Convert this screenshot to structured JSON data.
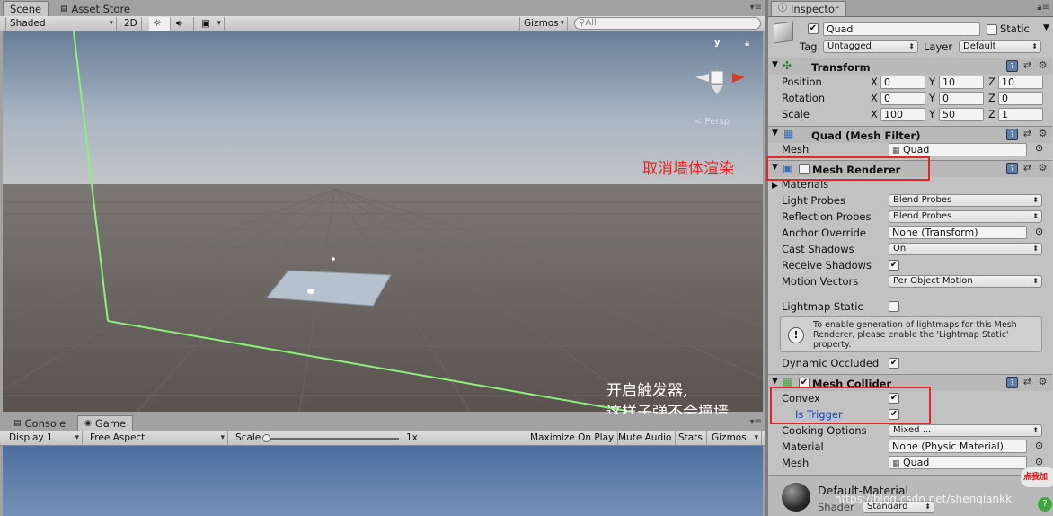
{
  "scene": {
    "tabs": [
      "Scene",
      "Asset Store"
    ],
    "toolbar": {
      "shading": "Shaded",
      "mode_2d": "2D",
      "gizmos": "Gizmos",
      "search_placeholder": "All"
    },
    "gizmo": {
      "y_axis": "y",
      "persp": "< Persp"
    }
  },
  "game": {
    "tabs": [
      "Console",
      "Game"
    ],
    "toolbar": {
      "display": "Display 1",
      "aspect": "Free Aspect",
      "scale_label": "Scale",
      "scale_value": "1x",
      "maximize": "Maximize On Play",
      "mute": "Mute Audio",
      "stats": "Stats",
      "gizmos": "Gizmos"
    }
  },
  "inspector": {
    "tab": "Inspector",
    "object_name": "Quad",
    "static_label": "Static",
    "tag_label": "Tag",
    "tag_value": "Untagged",
    "layer_label": "Layer",
    "layer_value": "Default",
    "transform": {
      "title": "Transform",
      "rows": [
        {
          "label": "Position",
          "x": "0",
          "y": "10",
          "z": "10"
        },
        {
          "label": "Rotation",
          "x": "0",
          "y": "0",
          "z": "0"
        },
        {
          "label": "Scale",
          "x": "100",
          "y": "50",
          "z": "1"
        }
      ],
      "axis": [
        "X",
        "Y",
        "Z"
      ]
    },
    "mesh_filter": {
      "title": "Quad (Mesh Filter)",
      "mesh_label": "Mesh",
      "mesh_value": "Quad"
    },
    "mesh_renderer": {
      "title": "Mesh Renderer",
      "materials": "Materials",
      "light_probes_label": "Light Probes",
      "light_probes_value": "Blend Probes",
      "reflection_probes_label": "Reflection Probes",
      "reflection_probes_value": "Blend Probes",
      "anchor_label": "Anchor Override",
      "anchor_value": "None (Transform)",
      "cast_shadows_label": "Cast Shadows",
      "cast_shadows_value": "On",
      "receive_shadows_label": "Receive Shadows",
      "motion_vectors_label": "Motion Vectors",
      "motion_vectors_value": "Per Object Motion",
      "lightmap_static_label": "Lightmap Static",
      "info_text": "To enable generation of lightmaps for this Mesh Renderer, please enable the 'Lightmap Static' property.",
      "dynamic_occluded_label": "Dynamic Occluded"
    },
    "mesh_collider": {
      "title": "Mesh Collider",
      "convex_label": "Convex",
      "is_trigger_label": "Is Trigger",
      "cooking_label": "Cooking Options",
      "cooking_value": "Mixed ...",
      "material_label": "Material",
      "material_value": "None (Physic Material)",
      "mesh_label": "Mesh",
      "mesh_value": "Quad"
    },
    "material": {
      "name": "Default-Material",
      "shader_label": "Shader",
      "shader_value": "Standard"
    }
  },
  "annotations": {
    "disable_render": "取消墙体渲染",
    "trigger_line1": "开启触发器,",
    "trigger_line2": "这样子弹不会撞墙"
  },
  "watermark": "https://blog.csdn.net/shenqiankk",
  "badge": "点我加"
}
